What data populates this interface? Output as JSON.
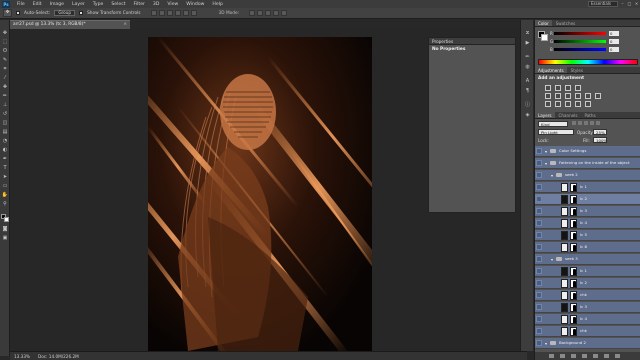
{
  "menubar": {
    "logo": "Ps",
    "items": [
      "File",
      "Edit",
      "Image",
      "Layer",
      "Type",
      "Select",
      "Filter",
      "3D",
      "View",
      "Window",
      "Help"
    ],
    "workspace": "Essentials"
  },
  "options": {
    "auto_select_label": "Auto-Select:",
    "auto_select_value": "Group",
    "transform_label": "Show Transform Controls",
    "mode_label": "3D Mode:"
  },
  "document": {
    "tab_title": "arr27.psd @ 13.3% (tc 3, RGB/8)*",
    "close": "×"
  },
  "status": {
    "zoom": "13.33%",
    "doc": "Doc: 14.0M/226.2M"
  },
  "properties": {
    "title": "Properties",
    "message": "No Properties"
  },
  "color_panel": {
    "tabs": [
      "Color",
      "Swatches"
    ],
    "rows": [
      {
        "letter": "R",
        "value": "0"
      },
      {
        "letter": "G",
        "value": "0"
      },
      {
        "letter": "B",
        "value": "0"
      }
    ]
  },
  "adjustments": {
    "tabs": [
      "Adjustments",
      "Styles"
    ],
    "title": "Add an adjustment"
  },
  "layers": {
    "tabs": [
      "Layers",
      "Channels",
      "Paths"
    ],
    "kind": "Kind",
    "blend_mode": "Pin Light",
    "opacity_label": "Opacity:",
    "opacity_value": "25%",
    "lock_label": "Lock:",
    "fill_label": "Fill:",
    "fill_value": "100%",
    "rows": [
      {
        "name": "Color Settings",
        "type": "group",
        "indent": 0,
        "selected": false
      },
      {
        "name": "Fattening on the inside of the object",
        "type": "group",
        "indent": 0,
        "selected": false
      },
      {
        "name": "seek 2",
        "type": "group",
        "indent": 1,
        "selected": false
      },
      {
        "name": "lc 1",
        "type": "layer",
        "indent": 2,
        "selected": false
      },
      {
        "name": "lc 2",
        "type": "layer",
        "indent": 2,
        "selected": true
      },
      {
        "name": "lc 3",
        "type": "layer",
        "indent": 2,
        "selected": false
      },
      {
        "name": "lc 4",
        "type": "layer",
        "indent": 2,
        "selected": false
      },
      {
        "name": "lc 5",
        "type": "layer",
        "indent": 2,
        "selected": false
      },
      {
        "name": "lc 6",
        "type": "layer",
        "indent": 2,
        "selected": false
      },
      {
        "name": "seek 3",
        "type": "group",
        "indent": 1,
        "selected": false
      },
      {
        "name": "lc 1",
        "type": "layer",
        "indent": 2,
        "selected": false
      },
      {
        "name": "lc 2",
        "type": "layer",
        "indent": 2,
        "selected": false
      },
      {
        "name": "chk",
        "type": "layer",
        "indent": 2,
        "selected": false
      },
      {
        "name": "lc 3",
        "type": "layer",
        "indent": 2,
        "selected": false
      },
      {
        "name": "lc 4",
        "type": "layer",
        "indent": 2,
        "selected": false
      },
      {
        "name": "chk",
        "type": "layer",
        "indent": 2,
        "selected": false
      },
      {
        "name": "Background 2",
        "type": "group",
        "indent": 0,
        "selected": false
      }
    ]
  }
}
